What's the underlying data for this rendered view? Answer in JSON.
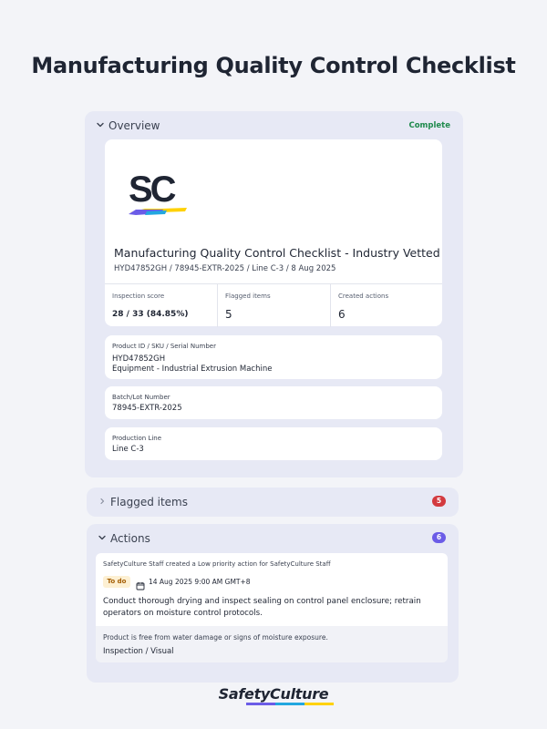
{
  "page": {
    "title": "Manufacturing Quality Control Checklist"
  },
  "overview": {
    "section_title": "Overview",
    "status": "Complete",
    "logo_text": "SC",
    "inspection_title": "Manufacturing Quality Control Checklist - Industry Vetted",
    "inspection_subtitle": "HYD47852GH / 78945-EXTR-2025 / Line C-3 / 8 Aug 2025",
    "stats": {
      "score_label": "Inspection score",
      "score_value": "28 / 33 (84.85%)",
      "flagged_label": "Flagged items",
      "flagged_value": "5",
      "actions_label": "Created actions",
      "actions_value": "6"
    },
    "fields": {
      "product_label": "Product ID / SKU / Serial Number",
      "product_value_line1": "HYD47852GH",
      "product_value_line2": "Equipment - Industrial Extrusion Machine",
      "batch_label": "Batch/Lot Number",
      "batch_value": "78945-EXTR-2025",
      "line_label": "Production Line",
      "line_value": "Line C-3"
    }
  },
  "flagged": {
    "section_title": "Flagged items",
    "count": "5"
  },
  "actions": {
    "section_title": "Actions",
    "count": "6",
    "item": {
      "creator_text": "SafetyCulture Staff created a Low priority action for SafetyCulture Staff",
      "status": "To do",
      "due": "14 Aug 2025 9:00 AM GMT+8",
      "title": "Conduct thorough drying and inspect sealing on control panel enclosure; retrain operators on moisture control protocols.",
      "description": "Product is free from water damage or signs of moisture exposure.",
      "type": "Inspection / Visual"
    }
  },
  "footer": {
    "brand": "SafetyCulture"
  },
  "colors": {
    "panel_bg": "#e7e9f5",
    "complete_green": "#1e8a4c",
    "flag_badge": "#d33a3f",
    "action_badge": "#6b5ce7",
    "todo_bg": "#fdf0d3"
  }
}
